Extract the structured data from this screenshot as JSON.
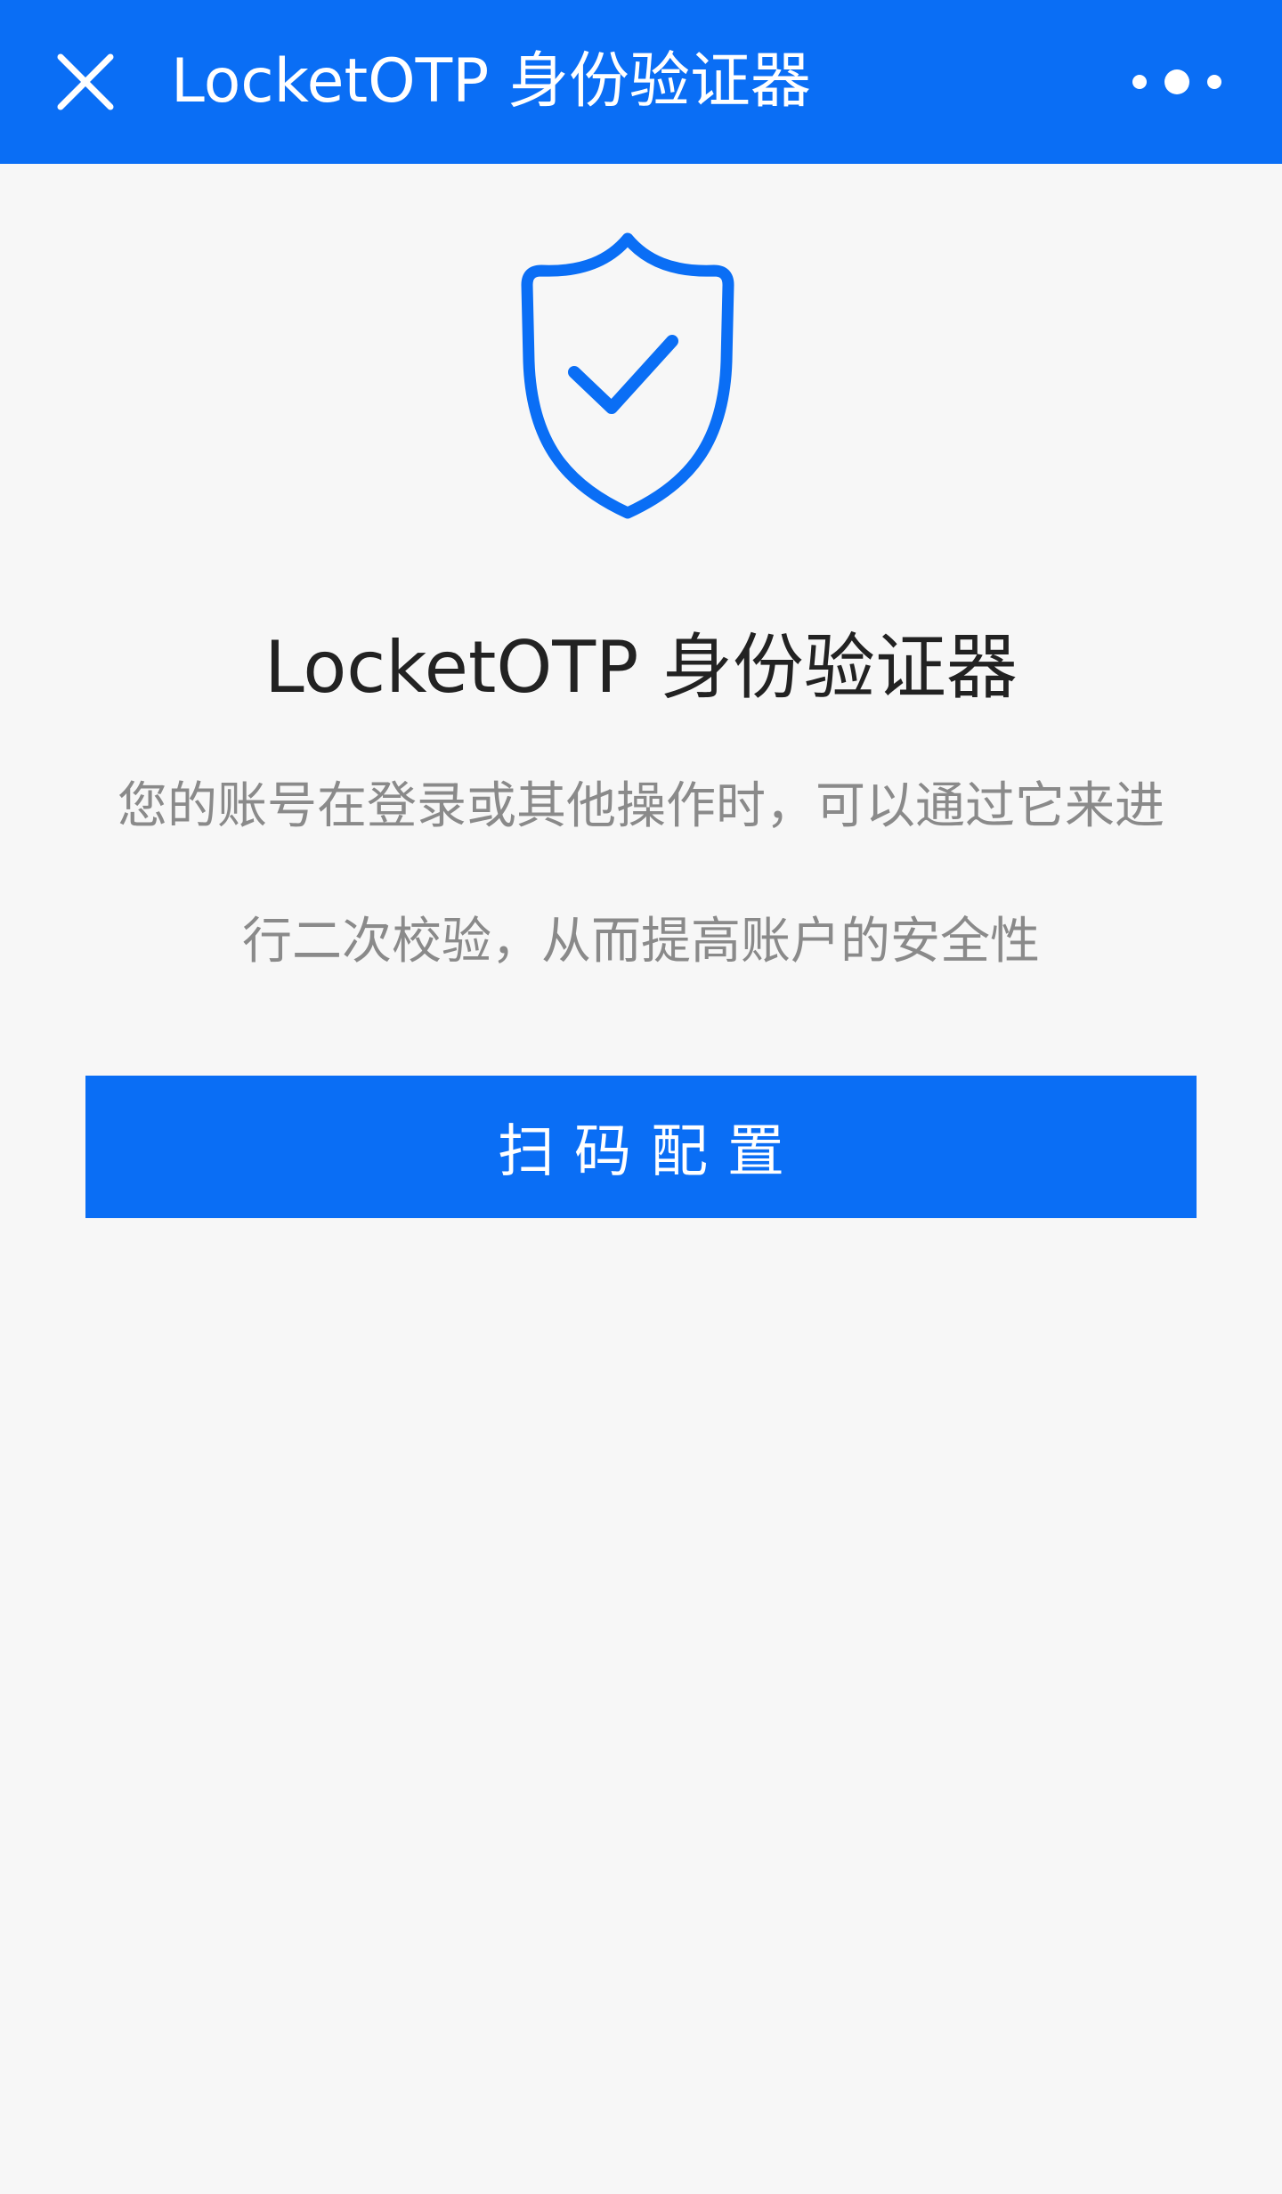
{
  "header": {
    "title": "LocketOTP 身份验证器",
    "close_icon": "close-icon",
    "more_icon": "more-dots-icon"
  },
  "main": {
    "icon": "shield-check-icon",
    "title": "LocketOTP 身份验证器",
    "description_lines": [
      "您的账号在登录或其他操作时，可以通过它来进",
      "行二次校验，从而提高账户的安全性"
    ],
    "scan_button_label": "扫码配置"
  },
  "colors": {
    "brand": "#0a6ef5",
    "background": "#f7f7f7",
    "heading_text": "#222222",
    "muted_text": "#8a8a8a"
  }
}
